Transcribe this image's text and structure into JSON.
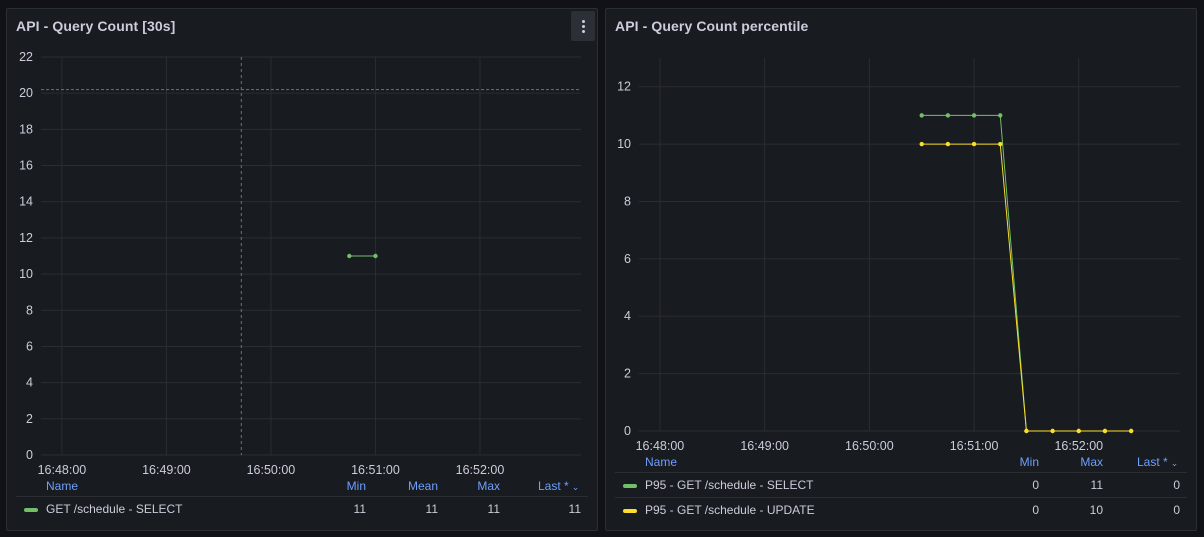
{
  "panels": [
    {
      "title": "API - Query Count [30s]",
      "menu_icon": "more-vertical-icon",
      "legend": {
        "headers": {
          "name": "Name",
          "min": "Min",
          "mean": "Mean",
          "max": "Max",
          "last": "Last *"
        },
        "rows": [
          {
            "name": "GET /schedule - SELECT",
            "color": "#73bf69",
            "min": "11",
            "mean": "11",
            "max": "11",
            "last": "11"
          }
        ]
      }
    },
    {
      "title": "API - Query Count percentile",
      "legend": {
        "headers": {
          "name": "Name",
          "min": "Min",
          "max": "Max",
          "last": "Last *"
        },
        "rows": [
          {
            "name": "P95 - GET /schedule - SELECT",
            "color": "#73bf69",
            "min": "0",
            "max": "11",
            "last": "0"
          },
          {
            "name": "P95 - GET /schedule - UPDATE",
            "color": "#fade2a",
            "min": "0",
            "max": "10",
            "last": "0"
          }
        ]
      }
    }
  ],
  "chart_data": [
    {
      "type": "line",
      "title": "API - Query Count [30s]",
      "x_ticks": [
        "16:48:00",
        "16:49:00",
        "16:50:00",
        "16:51:00",
        "16:52:00"
      ],
      "y_ticks": [
        0,
        2,
        4,
        6,
        8,
        10,
        12,
        14,
        16,
        18,
        20,
        22
      ],
      "ylim": [
        0,
        22
      ],
      "xlim": [
        "16:47:48",
        "16:52:58"
      ],
      "threshold": 20.2,
      "cursor_x": "16:49:43",
      "grid": true,
      "legend_placement": "bottom",
      "series": [
        {
          "name": "GET /schedule - SELECT",
          "color": "#73bf69",
          "points": [
            [
              "16:50:45",
              11
            ],
            [
              "16:51:00",
              11
            ]
          ]
        }
      ]
    },
    {
      "type": "line",
      "title": "API - Query Count percentile",
      "x_ticks": [
        "16:48:00",
        "16:49:00",
        "16:50:00",
        "16:51:00",
        "16:52:00"
      ],
      "y_ticks": [
        0,
        2,
        4,
        6,
        8,
        10,
        12
      ],
      "ylim": [
        0,
        13
      ],
      "xlim": [
        "16:47:48",
        "16:52:58"
      ],
      "grid": true,
      "legend_placement": "bottom",
      "series": [
        {
          "name": "P95 - GET /schedule - SELECT",
          "color": "#73bf69",
          "points": [
            [
              "16:50:30",
              11
            ],
            [
              "16:50:45",
              11
            ],
            [
              "16:51:00",
              11
            ],
            [
              "16:51:15",
              11
            ],
            [
              "16:51:30",
              0
            ],
            [
              "16:51:45",
              0
            ],
            [
              "16:52:00",
              0
            ],
            [
              "16:52:15",
              0
            ],
            [
              "16:52:30",
              0
            ]
          ]
        },
        {
          "name": "P95 - GET /schedule - UPDATE",
          "color": "#fade2a",
          "points": [
            [
              "16:50:30",
              10
            ],
            [
              "16:50:45",
              10
            ],
            [
              "16:51:00",
              10
            ],
            [
              "16:51:15",
              10
            ],
            [
              "16:51:30",
              0
            ],
            [
              "16:51:45",
              0
            ],
            [
              "16:52:00",
              0
            ],
            [
              "16:52:15",
              0
            ],
            [
              "16:52:30",
              0
            ]
          ]
        }
      ]
    }
  ]
}
